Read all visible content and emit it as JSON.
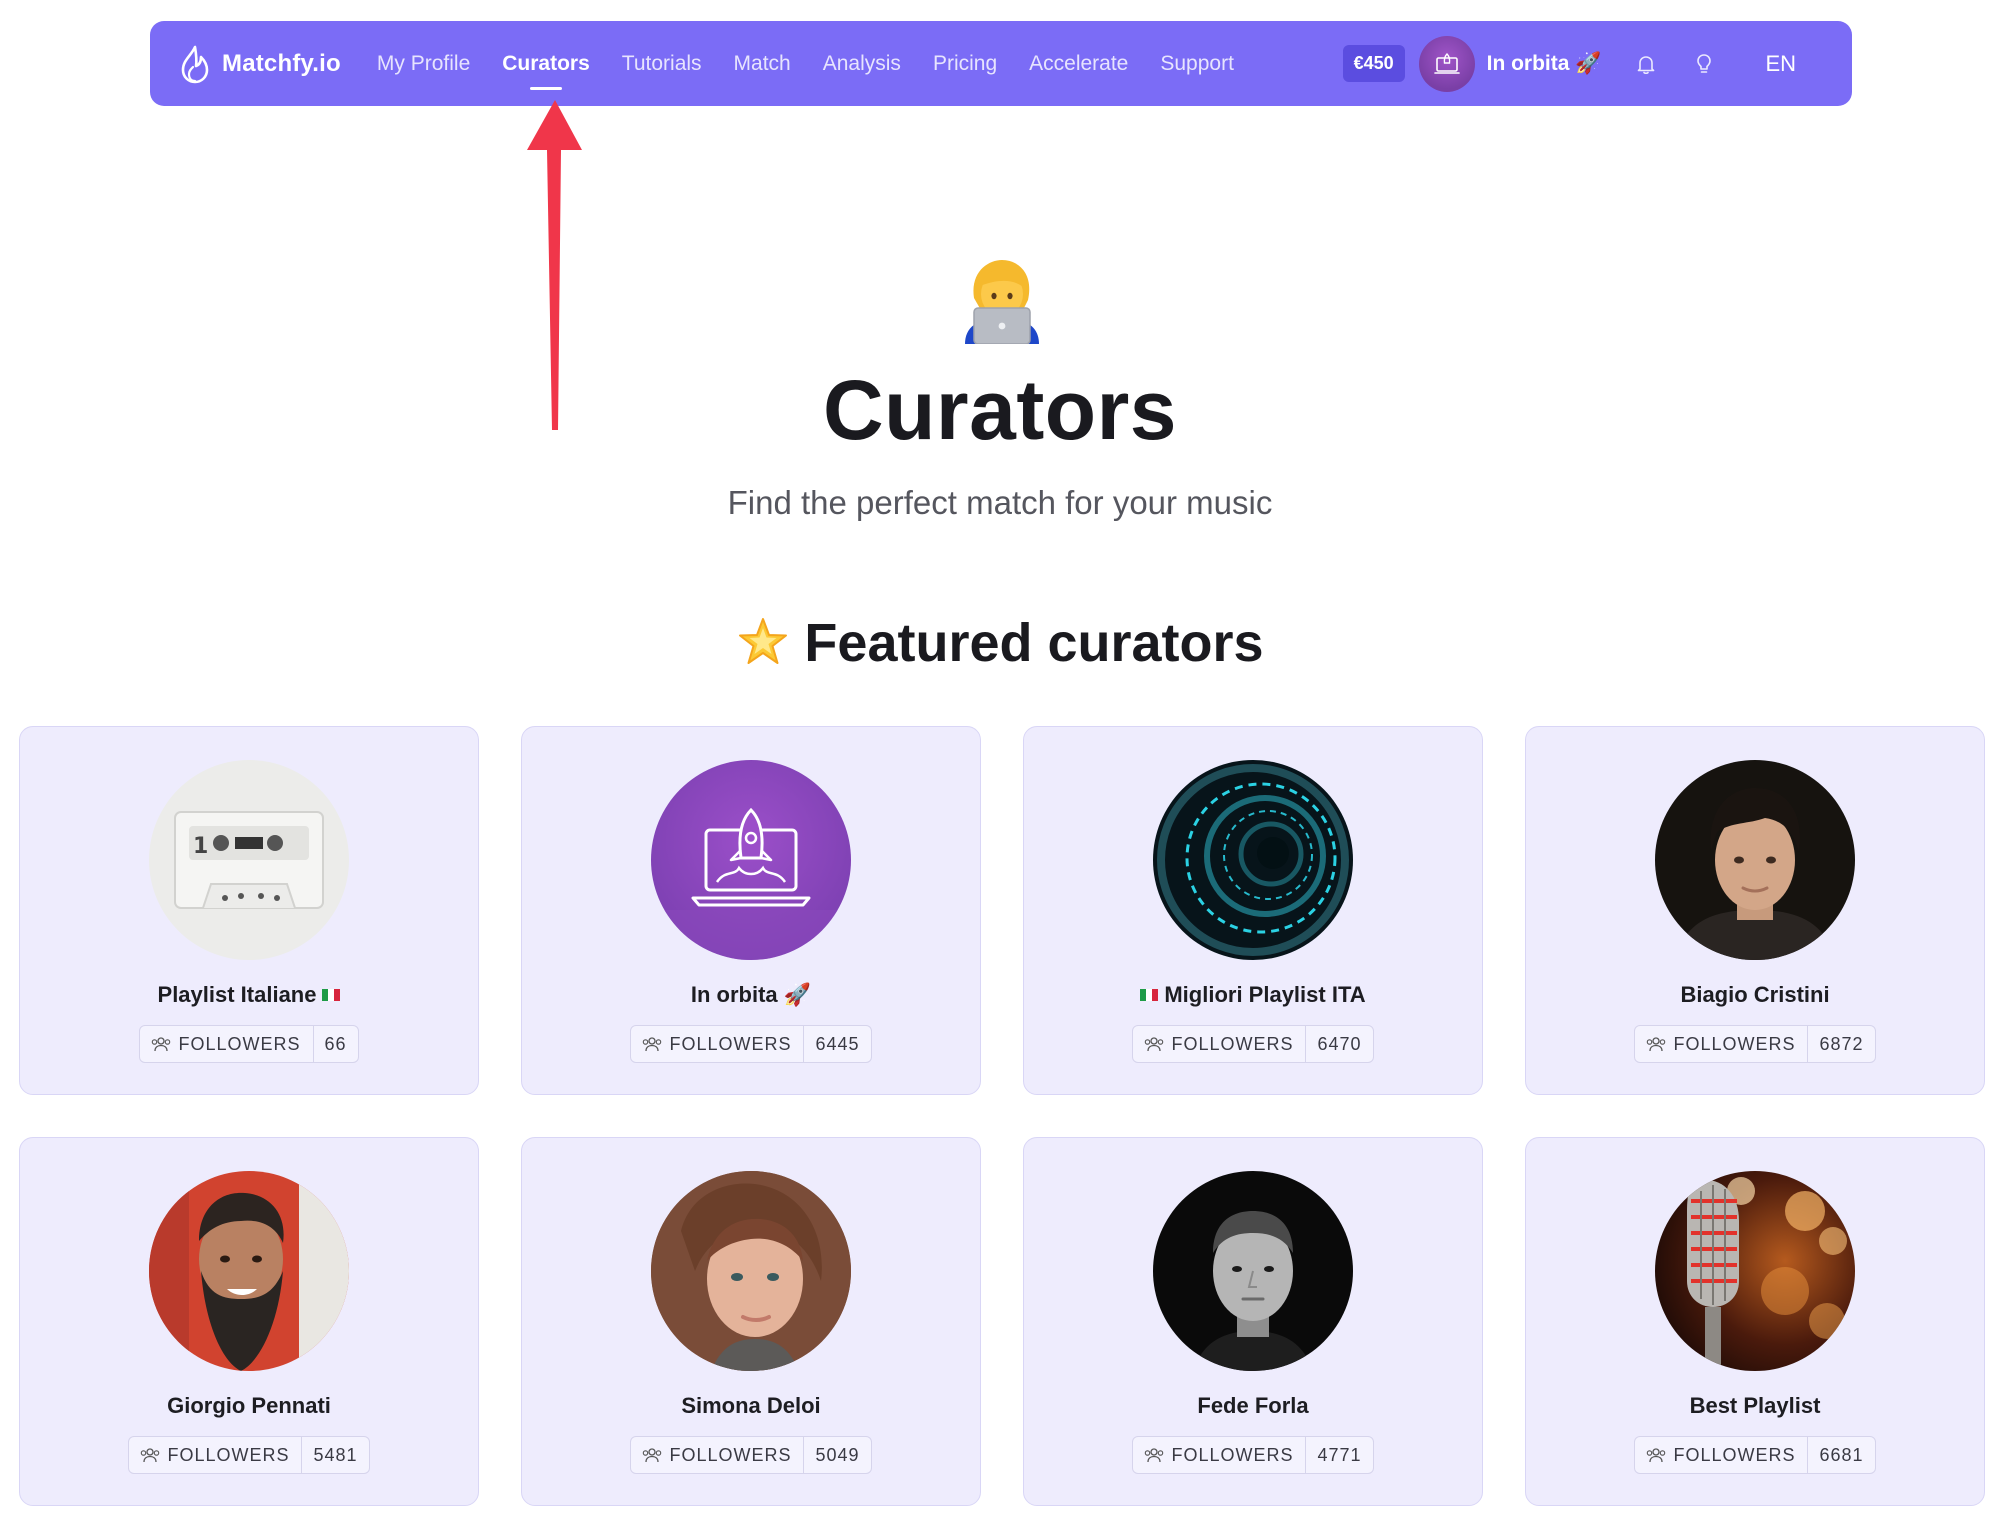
{
  "brand": {
    "name": "Matchfy.io"
  },
  "nav": {
    "links": [
      {
        "label": "My Profile",
        "active": false
      },
      {
        "label": "Curators",
        "active": true
      },
      {
        "label": "Tutorials",
        "active": false
      },
      {
        "label": "Match",
        "active": false
      },
      {
        "label": "Analysis",
        "active": false
      },
      {
        "label": "Pricing",
        "active": false
      },
      {
        "label": "Accelerate",
        "active": false
      },
      {
        "label": "Support",
        "active": false
      }
    ],
    "credit": "€450",
    "user": "In orbita 🚀",
    "language": "EN",
    "icons": [
      "bell-icon",
      "lightbulb-icon"
    ]
  },
  "hero": {
    "title": "Curators",
    "subtitle": "Find the perfect match for your music"
  },
  "featured": {
    "title": "Featured curators"
  },
  "curators": [
    {
      "name": "Playlist Italiane",
      "flag_after": true,
      "flag_before": false,
      "followers_label": "FOLLOWERS",
      "followers": "66"
    },
    {
      "name": "In orbita 🚀",
      "flag_after": false,
      "flag_before": false,
      "followers_label": "FOLLOWERS",
      "followers": "6445"
    },
    {
      "name": "Migliori Playlist ITA",
      "flag_after": false,
      "flag_before": true,
      "followers_label": "FOLLOWERS",
      "followers": "6470"
    },
    {
      "name": "Biagio Cristini",
      "flag_after": false,
      "flag_before": false,
      "followers_label": "FOLLOWERS",
      "followers": "6872"
    },
    {
      "name": "Giorgio Pennati",
      "flag_after": false,
      "flag_before": false,
      "followers_label": "FOLLOWERS",
      "followers": "5481"
    },
    {
      "name": "Simona Deloi",
      "flag_after": false,
      "flag_before": false,
      "followers_label": "FOLLOWERS",
      "followers": "5049"
    },
    {
      "name": "Fede Forla",
      "flag_after": false,
      "flag_before": false,
      "followers_label": "FOLLOWERS",
      "followers": "4771"
    },
    {
      "name": "Best Playlist",
      "flag_after": false,
      "flag_before": false,
      "followers_label": "FOLLOWERS",
      "followers": "6681"
    }
  ],
  "colors": {
    "navbar": "#7b6cf6",
    "card_bg": "#eeecfd",
    "arrow": "#f0364a"
  }
}
